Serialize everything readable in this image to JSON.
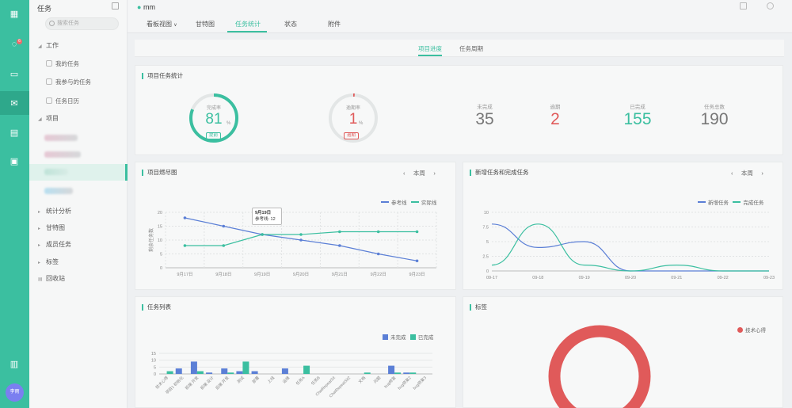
{
  "rail": {
    "badge": "6",
    "avatar": "李雨"
  },
  "sidebar": {
    "title": "任务",
    "search_placeholder": "搜索任务",
    "groups": [
      {
        "label": "工作"
      },
      {
        "label": "项目"
      },
      {
        "label": "统计分析"
      },
      {
        "label": "甘特图"
      },
      {
        "label": "成员任务"
      },
      {
        "label": "标签"
      },
      {
        "label": "回收站"
      }
    ],
    "work_items": [
      "我的任务",
      "我参与的任务",
      "任务日历"
    ]
  },
  "topbar": {
    "user": "mm",
    "tabs": [
      "看板视图",
      "甘特图",
      "任务统计",
      "状态",
      "附件"
    ]
  },
  "subnav": {
    "tabs": [
      "项目进度",
      "任务周期"
    ]
  },
  "stats": {
    "title": "项目任务统计",
    "ring1": {
      "label": "完成率",
      "value": "81",
      "unit": "%",
      "badge": "提前",
      "percent": 81,
      "color": "#3bbfa0"
    },
    "ring2": {
      "label": "逾期率",
      "value": "1",
      "unit": "%",
      "badge": "逾期",
      "percent": 1,
      "color": "#e05a5a"
    },
    "counters": [
      {
        "label": "未完成",
        "value": "35",
        "color": "#777777"
      },
      {
        "label": "逾期",
        "value": "2",
        "color": "#e05a5a"
      },
      {
        "label": "已完成",
        "value": "155",
        "color": "#3bbfa0"
      },
      {
        "label": "任务总数",
        "value": "190",
        "color": "#777777"
      }
    ]
  },
  "burndown": {
    "title": "项目燃尽图",
    "nav": "本周",
    "tooltip": {
      "title": "9月19日",
      "line": "参考线: 12"
    }
  },
  "newtasks": {
    "title": "新增任务和完成任务",
    "nav": "本周"
  },
  "tasklist": {
    "title": "任务列表"
  },
  "tags": {
    "title": "标签"
  },
  "chart_data": [
    {
      "type": "line",
      "title": "项目燃尽图",
      "ylabel": "剩余任务数",
      "categories": [
        "9月17日",
        "9月18日",
        "9月19日",
        "9月20日",
        "9月21日",
        "9月22日",
        "9月23日"
      ],
      "series": [
        {
          "name": "参考线",
          "color": "#5b7fd6",
          "values": [
            18,
            15,
            12,
            10,
            8,
            5,
            2.5
          ]
        },
        {
          "name": "实际线",
          "color": "#3bbfa0",
          "values": [
            8,
            8,
            12,
            12,
            13,
            13,
            13
          ]
        }
      ],
      "ylim": [
        0,
        20
      ],
      "yticks": [
        0,
        5,
        10,
        15,
        20
      ],
      "legend": "top-right"
    },
    {
      "type": "line",
      "title": "新增任务和完成任务",
      "categories": [
        "09-17",
        "09-18",
        "09-19",
        "09-20",
        "09-21",
        "09-22",
        "09-23"
      ],
      "series": [
        {
          "name": "新增任务",
          "color": "#5b7fd6",
          "values": [
            8,
            4,
            5,
            0,
            0,
            0,
            0
          ]
        },
        {
          "name": "完成任务",
          "color": "#3bbfa0",
          "values": [
            1,
            8,
            1,
            0,
            1,
            0,
            0
          ]
        }
      ],
      "ylim": [
        0,
        10
      ],
      "yticks": [
        0,
        2.5,
        5,
        7.5,
        10
      ],
      "legend": "top-right"
    },
    {
      "type": "bar",
      "title": "任务列表",
      "categories": [
        "技术心得",
        "项目1 初始化",
        "前端 开发",
        "前端 设计",
        "后端 开发",
        "测试",
        "部署",
        "上线",
        "运维",
        "任务A",
        "任务B",
        "ChatRepeatSit",
        "ChatRepeatSit2",
        "文档",
        "问题",
        "bug修复",
        "bug修复2",
        "bug修复3"
      ],
      "series": [
        {
          "name": "未完成",
          "color": "#5b7fd6",
          "values": [
            0,
            4,
            9,
            1,
            4,
            2,
            2,
            0,
            4,
            0,
            0,
            0,
            0,
            0,
            0,
            6,
            1,
            0
          ]
        },
        {
          "name": "已完成",
          "color": "#3bbfa0",
          "values": [
            2,
            0,
            2,
            0,
            1,
            9,
            0,
            0,
            0,
            6,
            0,
            0,
            0,
            1,
            0,
            1,
            1,
            0
          ]
        }
      ],
      "ylim": [
        0,
        15
      ],
      "yticks": [
        0,
        5,
        10,
        15
      ],
      "legend": "top-right"
    },
    {
      "type": "pie",
      "title": "标签",
      "slices": [
        {
          "name": "技术心得",
          "value": 100,
          "color": "#e05a5a"
        }
      ],
      "legend": "top-right"
    }
  ]
}
